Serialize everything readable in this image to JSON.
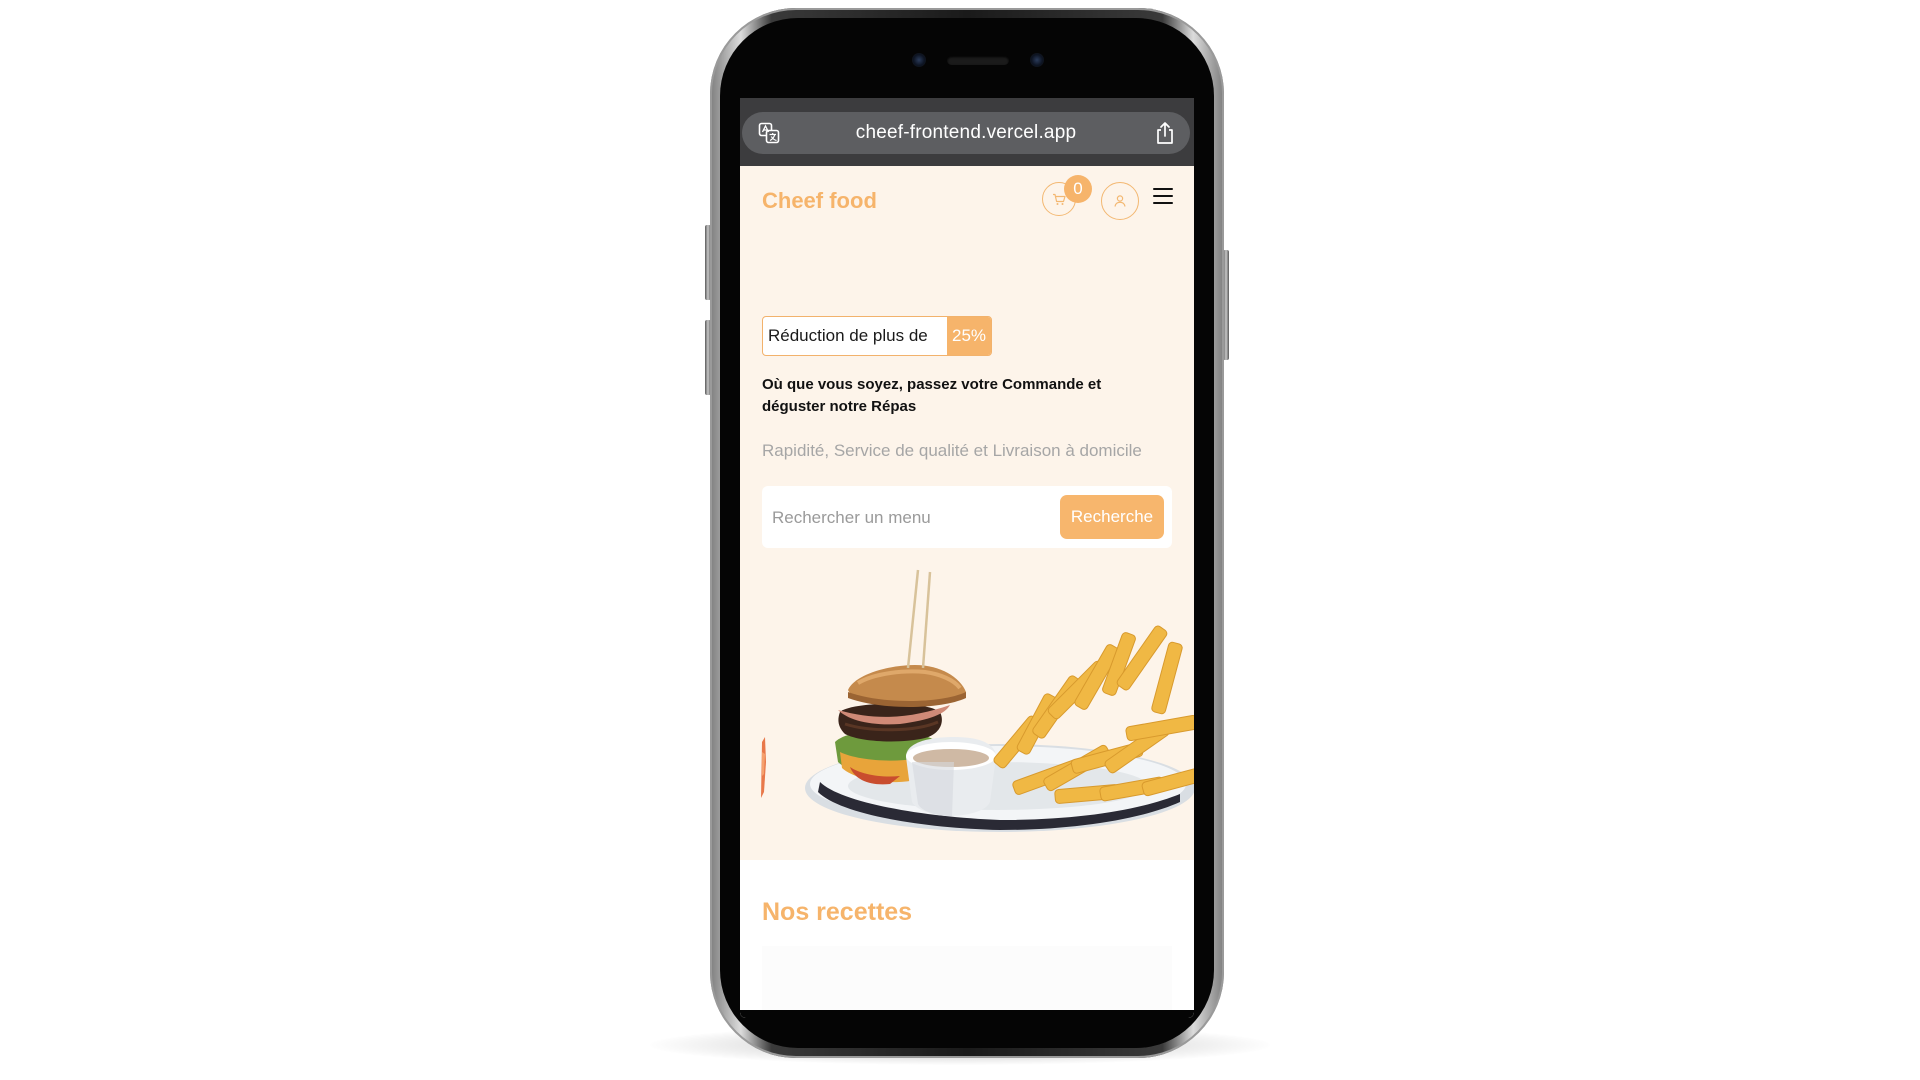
{
  "browser": {
    "url": "cheef-frontend.vercel.app",
    "icons": {
      "translate": "translate-icon",
      "share": "share-icon"
    }
  },
  "header": {
    "brand": "Cheef food",
    "cart_count": "0",
    "icons": {
      "cart": "cart-icon",
      "user": "user-icon",
      "menu": "hamburger-menu-icon"
    }
  },
  "hero": {
    "discount_label": "Réduction de plus de",
    "discount_value": "25%",
    "headline": "Où que vous soyez, passez votre Commande et déguster notre Répas",
    "subline": "Rapidité, Service de qualité et Livraison à domicile",
    "search": {
      "placeholder": "Rechercher un menu",
      "value": "",
      "button": "Recherche"
    }
  },
  "recipes": {
    "title": "Nos recettes"
  },
  "colors": {
    "accent": "#f6b46b",
    "hero_bg": "#fdf4ea",
    "browser_chrome": "#3c3c3e",
    "url_bar": "#5d5e61"
  }
}
